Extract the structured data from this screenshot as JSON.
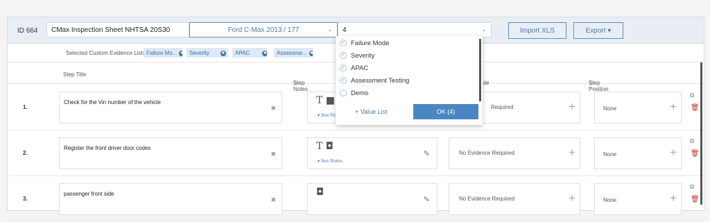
{
  "toolbar": {
    "id_label": "ID 664",
    "title_value": "CMax Inspection Sheet NHTSA 20S30",
    "vehicle_value": "Ford C-Max 2013 / 177",
    "list_value": "4",
    "import_label": "Import XLS",
    "export_label": "Export ▾"
  },
  "evidence_bar": {
    "label": "Selected Custom Evidence Lists:",
    "chips": [
      "Failure Mo...",
      "Severity",
      "APAC",
      "Assessme..."
    ]
  },
  "headers": {
    "step_title": "Step Title",
    "step_notes": "Step Notes",
    "evidence": "ce",
    "step_position": "Step Position",
    "info_icon": "ⓘ"
  },
  "rows": [
    {
      "num": "1.",
      "title": "Check for the Vin number of the vehicle",
      "notes_icons": "T ■ ◘",
      "see_notes": "▾ See Notes",
      "evidence": "Required",
      "position": "None"
    },
    {
      "num": "2.",
      "title": "Register the front driver door codes",
      "notes_icons": "T ◘",
      "see_notes": "▾ See Notes",
      "evidence": "No Evidence Required",
      "position": "None"
    },
    {
      "num": "3.",
      "title": "passenger front side",
      "notes_icons": "◘",
      "see_notes": "",
      "evidence": "No Evidence Required",
      "position": "None"
    }
  ],
  "dropdown": {
    "items": [
      {
        "label": "Failure Mode",
        "checked": true
      },
      {
        "label": "Severity",
        "checked": true
      },
      {
        "label": "APAC",
        "checked": true
      },
      {
        "label": "Assessment Testing",
        "checked": true
      },
      {
        "label": "Demo",
        "checked": false
      }
    ],
    "value_list_label": "+ Value List",
    "ok_label": "OK (4)"
  },
  "icons": {
    "clear": "✖",
    "pencil": "✎",
    "plus": "+",
    "copy": "⧉",
    "trash": "🗑",
    "chevron": "⌄",
    "check": "✓",
    "chip_x": "✖"
  },
  "colors": {
    "accent": "#4a86c2",
    "toolbar_bg": "#e8eef4",
    "danger": "#c0392b"
  }
}
